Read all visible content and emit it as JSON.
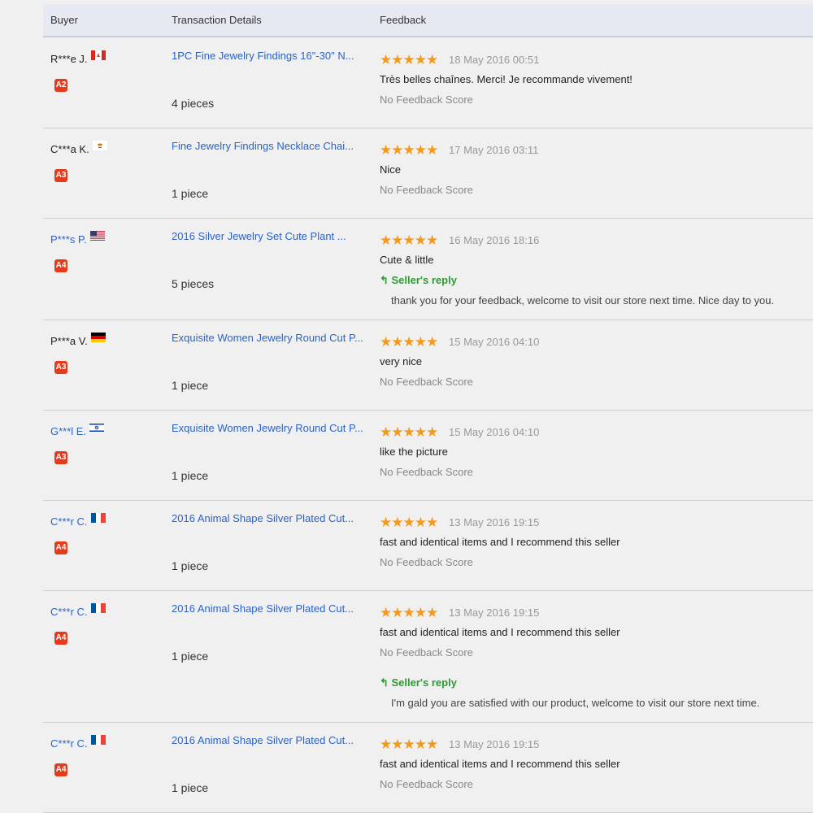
{
  "header": {
    "buyer": "Buyer",
    "transaction": "Transaction Details",
    "feedback": "Feedback"
  },
  "stars": "★★★★★",
  "score_text": "No Feedback Score",
  "reply_label": "↰ Seller's reply",
  "rows": [
    {
      "buyer": "R***e J.",
      "flag": "canada",
      "badge": "A2",
      "product": "1PC Fine Jewelry Findings 16\"-30\" N...",
      "qty": "4 pieces",
      "date": "18 May 2016 00:51",
      "comment": "Très belles chaînes. Merci! Je recommande vivement!"
    },
    {
      "buyer": "C***a K.",
      "flag": "cyprus",
      "badge": "A3",
      "product": "Fine Jewelry Findings Necklace Chai...",
      "qty": "1 piece",
      "date": "17 May 2016 03:11",
      "comment": "Nice"
    },
    {
      "buyer": "P***s P.",
      "flag": "usa",
      "badge": "A4",
      "product": "2016 Silver Jewelry Set Cute Plant ...",
      "qty": "5 pieces",
      "date": "16 May 2016 18:16",
      "comment": "Cute & little",
      "reply": "thank you for your feedback, welcome to visit our store next time. Nice day to you."
    },
    {
      "buyer": "P***a V.",
      "flag": "germany",
      "badge": "A3",
      "product": "Exquisite Women Jewelry Round Cut P...",
      "qty": "1 piece",
      "date": "15 May 2016 04:10",
      "comment": "very nice"
    },
    {
      "buyer": "G***l E.",
      "flag": "israel",
      "badge": "A3",
      "product": "Exquisite Women Jewelry Round Cut P...",
      "qty": "1 piece",
      "date": "15 May 2016 04:10",
      "comment": "like the picture"
    },
    {
      "buyer": "C***r C.",
      "flag": "france",
      "badge": "A4",
      "product": "2016 Animal Shape Silver Plated Cut...",
      "qty": "1 piece",
      "date": "13 May 2016 19:15",
      "comment": "fast and identical items and I recommend this seller"
    },
    {
      "buyer": "C***r C.",
      "flag": "france",
      "badge": "A4",
      "product": "2016 Animal Shape Silver Plated Cut...",
      "qty": "1 piece",
      "date": "13 May 2016 19:15",
      "comment": "fast and identical items and I recommend this seller",
      "reply": "I'm gald you are satisfied with our product, welcome to visit our store next time."
    },
    {
      "buyer": "C***r C.",
      "flag": "france",
      "badge": "A4",
      "product": "2016 Animal Shape Silver Plated Cut...",
      "qty": "1 piece",
      "date": "13 May 2016 19:15",
      "comment": "fast and identical items and I recommend this seller"
    }
  ]
}
